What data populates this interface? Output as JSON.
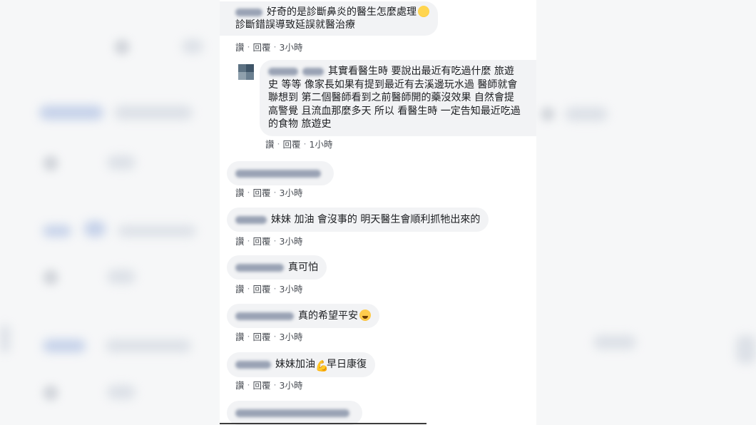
{
  "comments": [
    {
      "text_line1": "好奇的是診斷鼻炎的醫生怎麼處理",
      "text_line2": "診斷錯誤導致延誤就醫治療",
      "emoji": "thinking-face",
      "like": "讚",
      "reply": "回覆",
      "time": "3小時"
    },
    {
      "reply_lines": [
        "其實看醫生時 要說出最近有吃過什麼 旅遊",
        "史 等等 像家長如果有提到最近有去溪邊玩水過 醫師就會",
        "聯想到 第二個醫師看到之前醫師開的藥沒效果 自然會提",
        "高警覺 且流血那麼多天 所以 看醫生時 一定告知最近吃過",
        "的食物 旅遊史"
      ],
      "like": "讚",
      "reply": "回覆",
      "time": "1小時"
    },
    {
      "text": "",
      "like": "讚",
      "reply": "回覆",
      "time": "3小時"
    },
    {
      "text": "妹妹 加油 會沒事的 明天醫生會順利抓牠出來的",
      "like": "讚",
      "reply": "回覆",
      "time": "3小時"
    },
    {
      "text": "真可怕",
      "like": "讚",
      "reply": "回覆",
      "time": "3小時"
    },
    {
      "text": "真的希望平安",
      "emoji": "crying-face",
      "like": "讚",
      "reply": "回覆",
      "time": "3小時"
    },
    {
      "text_a": "妹妹加油",
      "emoji": "flexed-biceps",
      "text_b": "早日康復",
      "like": "讚",
      "reply": "回覆",
      "time": "3小時"
    }
  ],
  "separator": "·"
}
